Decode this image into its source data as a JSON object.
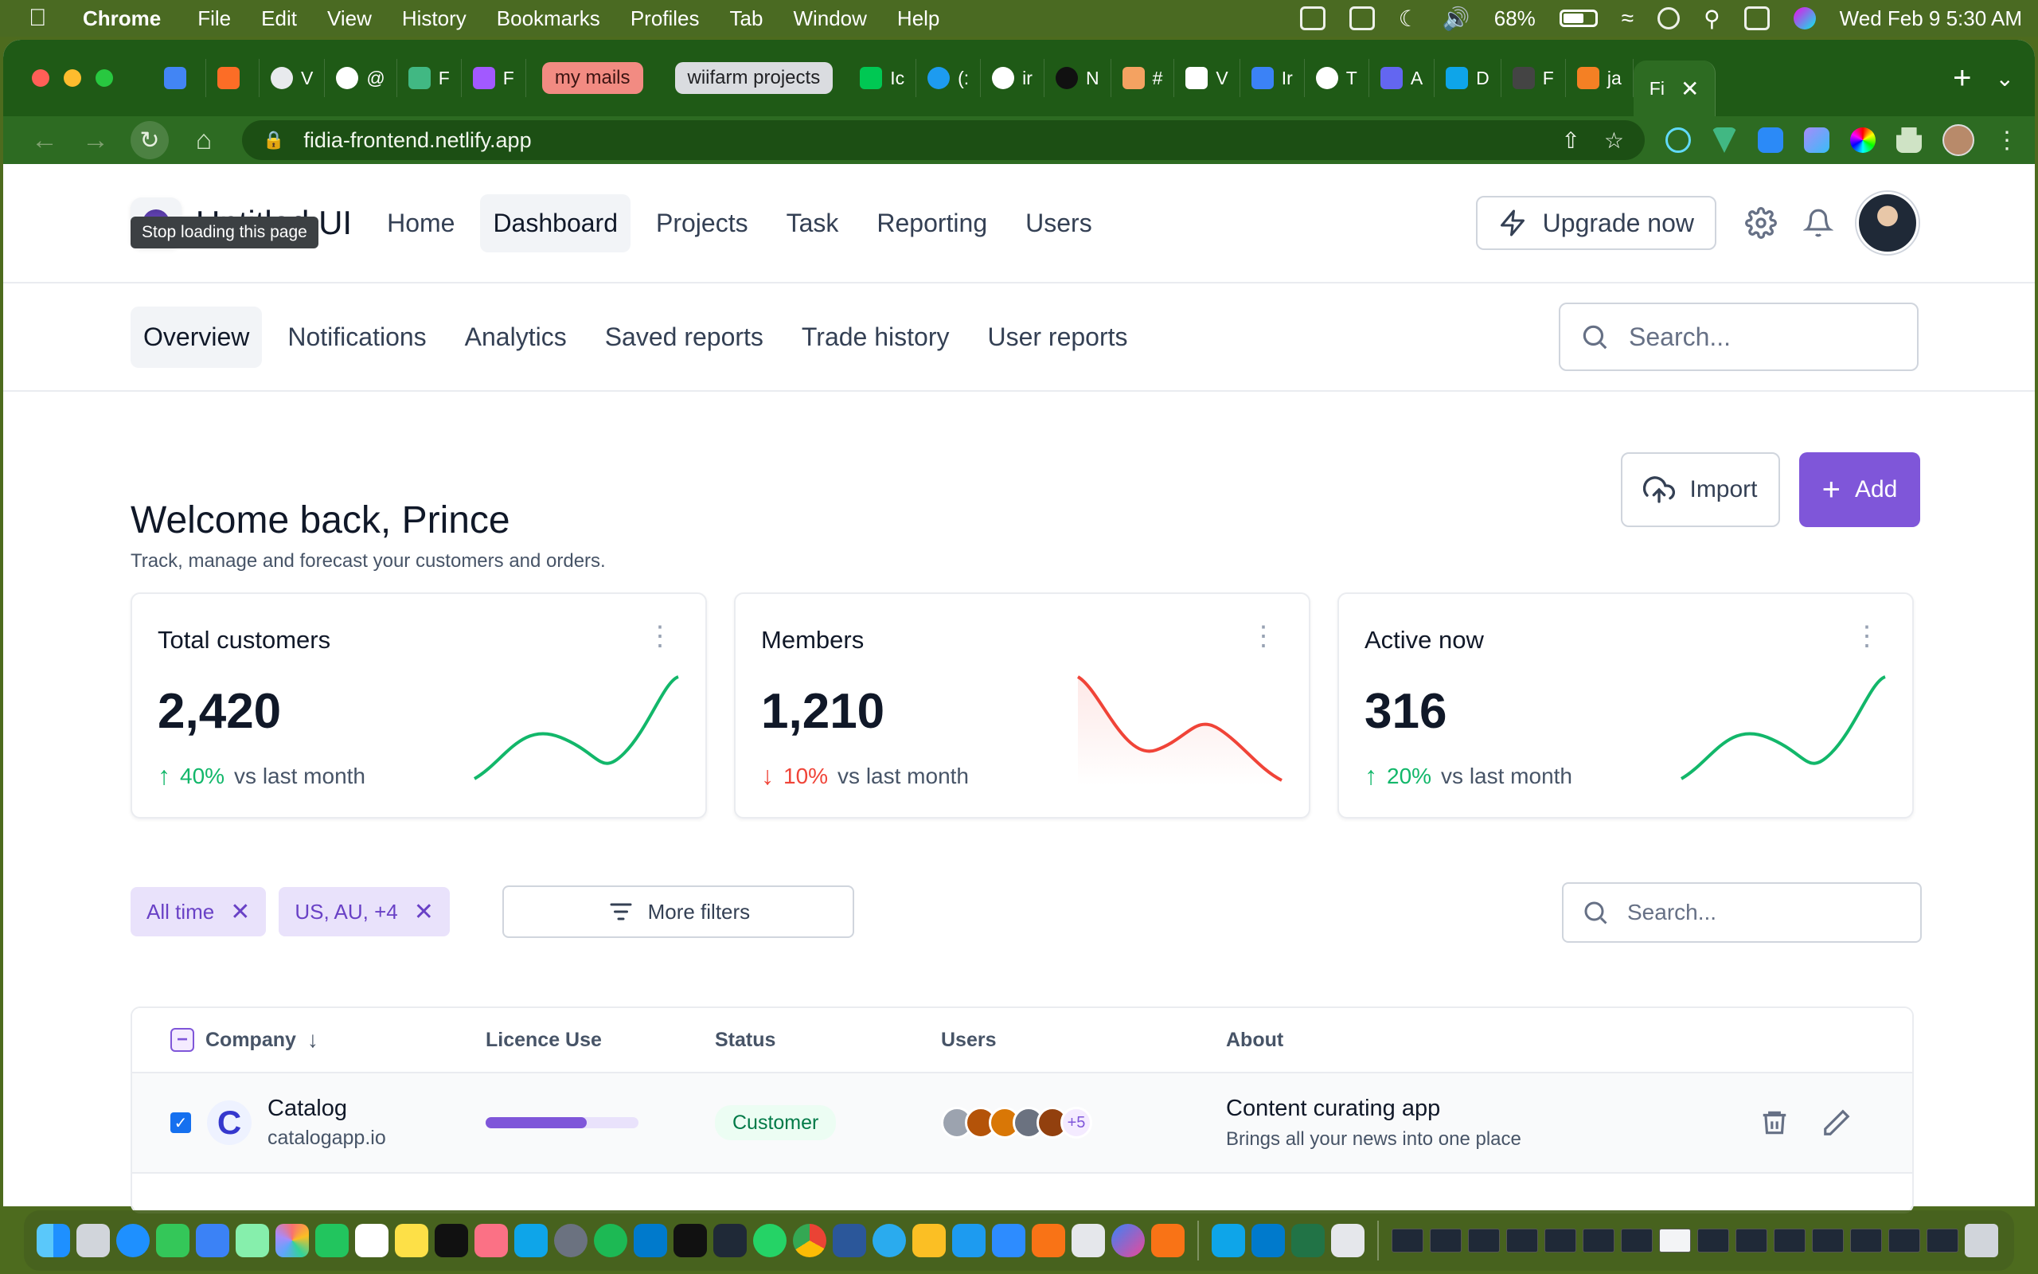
{
  "menubar": {
    "app_name": "Chrome",
    "items": [
      "File",
      "Edit",
      "View",
      "History",
      "Bookmarks",
      "Profiles",
      "Tab",
      "Window",
      "Help"
    ],
    "battery": "68%",
    "datetime": "Wed Feb 9  5:30 AM"
  },
  "browser": {
    "tabs": [
      {
        "label": "",
        "color": "#4285f4"
      },
      {
        "label": "",
        "color": "#fc6d26"
      },
      {
        "label": "V",
        "color": "#e8eaed"
      },
      {
        "label": "@",
        "color": "#ffffff"
      },
      {
        "label": "F",
        "color": "#41b883"
      },
      {
        "label": "F",
        "color": "#a259ff"
      }
    ],
    "group_mail": "my mails",
    "group_projects": "wiifarm projects",
    "tabs_after": [
      {
        "label": "Ic",
        "color": "#00c853"
      },
      {
        "label": "(:",
        "color": "#1d9bf0"
      },
      {
        "label": "ir",
        "color": "#ffffff"
      },
      {
        "label": "N",
        "color": "#111111"
      },
      {
        "label": "#",
        "color": "#f4a261"
      },
      {
        "label": "V",
        "color": "#ffffff"
      },
      {
        "label": "Ir",
        "color": "#3b82f6"
      },
      {
        "label": "T",
        "color": "#ffffff"
      },
      {
        "label": "A",
        "color": "#6366f1"
      },
      {
        "label": "D",
        "color": "#0ea5e9"
      },
      {
        "label": "F",
        "color": "#444444"
      },
      {
        "label": "ja",
        "color": "#f48024"
      }
    ],
    "active_tab": "Fi",
    "url": "fidia-frontend.netlify.app",
    "tooltip": "Stop loading this page"
  },
  "app": {
    "logo_text": "Untitled UI",
    "nav": [
      "Home",
      "Dashboard",
      "Projects",
      "Task",
      "Reporting",
      "Users"
    ],
    "active_nav": "Dashboard",
    "upgrade_label": "Upgrade now",
    "subnav": [
      "Overview",
      "Notifications",
      "Analytics",
      "Saved reports",
      "Trade history",
      "User reports"
    ],
    "search_placeholder": "Search...",
    "welcome_title": "Welcome back, Prince",
    "welcome_subtitle": "Track, manage and forecast your customers and orders.",
    "import_label": "Import",
    "add_label": "Add"
  },
  "stats": [
    {
      "title": "Total customers",
      "value": "2,420",
      "change": "40%",
      "direction": "up",
      "suffix": "vs last month",
      "color": "#12b76a"
    },
    {
      "title": "Members",
      "value": "1,210",
      "change": "10%",
      "direction": "down",
      "suffix": "vs last month",
      "color": "#f04438"
    },
    {
      "title": "Active now",
      "value": "316",
      "change": "20%",
      "direction": "up",
      "suffix": "vs last month",
      "color": "#12b76a"
    }
  ],
  "filters": {
    "chips": [
      "All time",
      "US, AU, +4"
    ],
    "more_filters": "More filters",
    "search_placeholder": "Search..."
  },
  "table": {
    "headers": {
      "company": "Company",
      "licence": "Licence Use",
      "status": "Status",
      "users": "Users",
      "about": "About"
    },
    "rows": [
      {
        "company": "Catalog",
        "url": "catalogapp.io",
        "licence_fraction": 0.66,
        "status": "Customer",
        "users_more": "+5",
        "about_title": "Content curating app",
        "about_sub": "Brings all your news into one place"
      }
    ]
  }
}
